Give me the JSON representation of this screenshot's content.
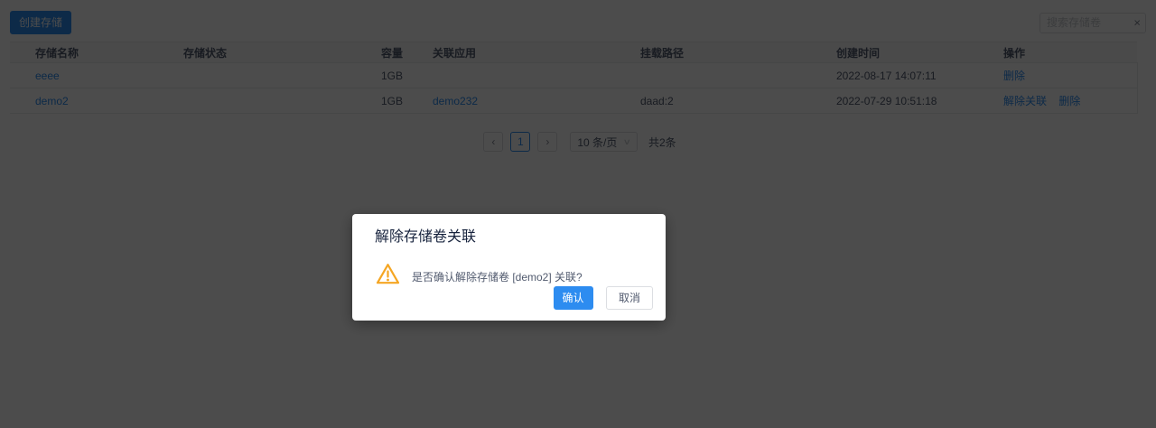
{
  "toolbar": {
    "create_button": "创建存储",
    "search_placeholder": "搜索存储卷"
  },
  "icons": {
    "clear": "×",
    "prev": "‹",
    "next": "›",
    "chevron_down": "∨"
  },
  "table": {
    "columns": [
      "存储名称",
      "存储状态",
      "容量",
      "关联应用",
      "挂载路径",
      "创建时间",
      "操作"
    ],
    "rows": [
      {
        "name": "eeee",
        "status": "",
        "capacity": "1GB",
        "app": "",
        "mount_path": "",
        "created_at": "2022-08-17 14:07:11",
        "actions": [
          "删除"
        ]
      },
      {
        "name": "demo2",
        "status": "",
        "capacity": "1GB",
        "app": "demo232",
        "mount_path": "daad:2",
        "created_at": "2022-07-29 10:51:18",
        "actions": [
          "解除关联",
          "删除"
        ]
      }
    ]
  },
  "pagination": {
    "current_page": "1",
    "page_size_label": "10 条/页",
    "total_label": "共2条"
  },
  "modal": {
    "title": "解除存储卷关联",
    "message": "是否确认解除存储卷 [demo2] 关联?",
    "confirm_label": "确认",
    "cancel_label": "取消"
  },
  "colors": {
    "primary": "#2d8cf0",
    "link": "#2d8cf0",
    "warning": "#f5a623",
    "table_border": "#e8eaec",
    "header_bg": "#f8f8f9",
    "overlay": "rgba(0,0,0,0.70)"
  }
}
